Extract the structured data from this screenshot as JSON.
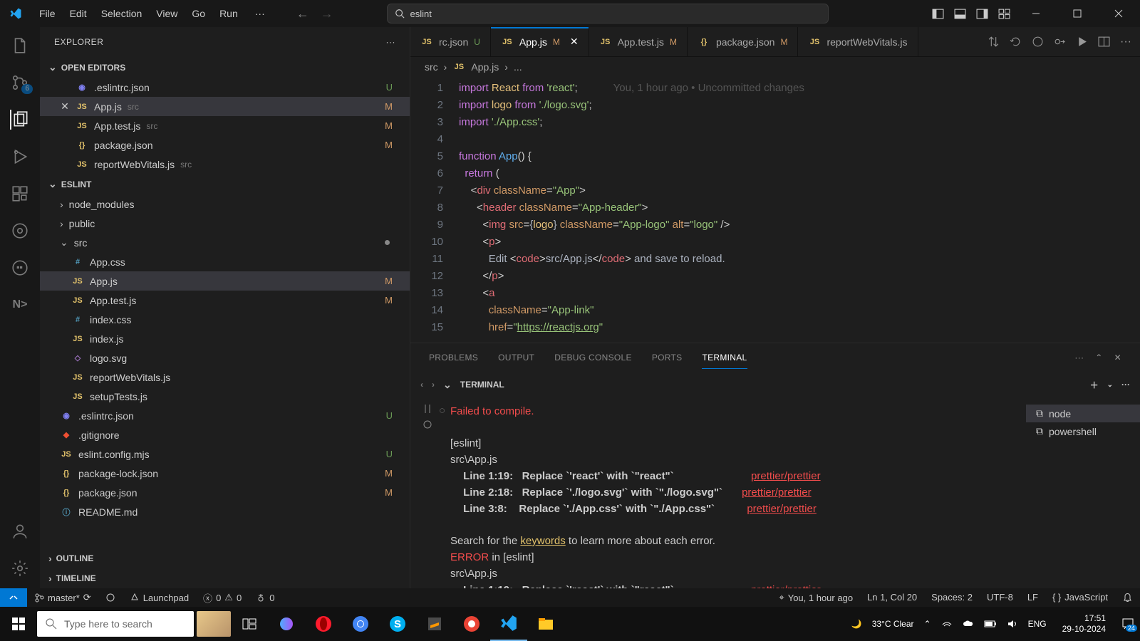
{
  "title_menu": [
    "File",
    "Edit",
    "Selection",
    "View",
    "Go",
    "Run"
  ],
  "search_term": "eslint",
  "explorer": {
    "title": "EXPLORER",
    "open_editors_label": "OPEN EDITORS",
    "open_editors": [
      {
        "name": ".eslintrc.json",
        "badge": "U",
        "icon": "eslint"
      },
      {
        "name": "App.js",
        "hint": "src",
        "badge": "M",
        "icon": "js",
        "active": true
      },
      {
        "name": "App.test.js",
        "hint": "src",
        "badge": "M",
        "icon": "js"
      },
      {
        "name": "package.json",
        "badge": "M",
        "icon": "json"
      },
      {
        "name": "reportWebVitals.js",
        "hint": "src",
        "icon": "js"
      }
    ],
    "project_label": "ESLINT",
    "tree": [
      {
        "name": "node_modules",
        "type": "folder"
      },
      {
        "name": "public",
        "type": "folder"
      },
      {
        "name": "src",
        "type": "folder",
        "open": true,
        "dot": true
      },
      {
        "name": "App.css",
        "icon": "css",
        "indent": true
      },
      {
        "name": "App.js",
        "icon": "js",
        "indent": true,
        "badge": "M",
        "selected": true
      },
      {
        "name": "App.test.js",
        "icon": "js",
        "indent": true,
        "badge": "M"
      },
      {
        "name": "index.css",
        "icon": "css",
        "indent": true
      },
      {
        "name": "index.js",
        "icon": "js",
        "indent": true
      },
      {
        "name": "logo.svg",
        "icon": "svg",
        "indent": true
      },
      {
        "name": "reportWebVitals.js",
        "icon": "js",
        "indent": true
      },
      {
        "name": "setupTests.js",
        "icon": "js",
        "indent": true
      },
      {
        "name": ".eslintrc.json",
        "icon": "eslint",
        "badge": "U"
      },
      {
        "name": ".gitignore",
        "icon": "git"
      },
      {
        "name": "eslint.config.mjs",
        "icon": "js",
        "badge": "U"
      },
      {
        "name": "package-lock.json",
        "icon": "json",
        "badge": "M"
      },
      {
        "name": "package.json",
        "icon": "json",
        "badge": "M"
      },
      {
        "name": "README.md",
        "icon": "md"
      }
    ],
    "outline_label": "OUTLINE",
    "timeline_label": "TIMELINE"
  },
  "tabs": [
    {
      "name": "rc.json",
      "badge": "U",
      "icon": "JS",
      "partial": true
    },
    {
      "name": "App.js",
      "badge": "M",
      "icon": "JS",
      "active": true,
      "close": true
    },
    {
      "name": "App.test.js",
      "badge": "M",
      "icon": "JS"
    },
    {
      "name": "package.json",
      "badge": "M",
      "icon": "{}"
    },
    {
      "name": "reportWebVitals.js",
      "icon": "JS"
    }
  ],
  "breadcrumb": [
    "src",
    "App.js",
    "..."
  ],
  "code_blame": "You, 1 hour ago • Uncommitted changes",
  "panel": {
    "tabs": [
      "PROBLEMS",
      "OUTPUT",
      "DEBUG CONSOLE",
      "PORTS",
      "TERMINAL"
    ],
    "active": "TERMINAL",
    "terminal_label": "TERMINAL",
    "shells": [
      {
        "name": "node",
        "active": true
      },
      {
        "name": "powershell"
      }
    ],
    "out": {
      "fail": "Failed to compile.",
      "eslint": "[eslint]",
      "file": "src\\App.js",
      "l1": "Line 1:19:   Replace `'react'` with `\"react\"`",
      "l2": "Line 2:18:   Replace `'./logo.svg'` with `\"./logo.svg\"`",
      "l3": "Line 3:8:    Replace `'./App.css'` with `\"./App.css\"`",
      "rule": "prettier/prettier",
      "search": "Search for the ",
      "search_kw": "keywords",
      "search2": " to learn more about each error.",
      "err": "ERROR",
      "err2": " in [eslint]"
    }
  },
  "status": {
    "branch": "master*",
    "launchpad": "Launchpad",
    "errors": "0",
    "warnings": "0",
    "port": "0",
    "blame": "You, 1 hour ago",
    "pos": "Ln 1, Col 20",
    "spaces": "Spaces: 2",
    "enc": "UTF-8",
    "eol": "LF",
    "lang": "JavaScript"
  },
  "scm_badge": "6",
  "taskbar": {
    "search_placeholder": "Type here to search",
    "weather": "33°C  Clear",
    "lang": "ENG",
    "time": "17:51",
    "date": "29-10-2024",
    "notif": "24"
  }
}
